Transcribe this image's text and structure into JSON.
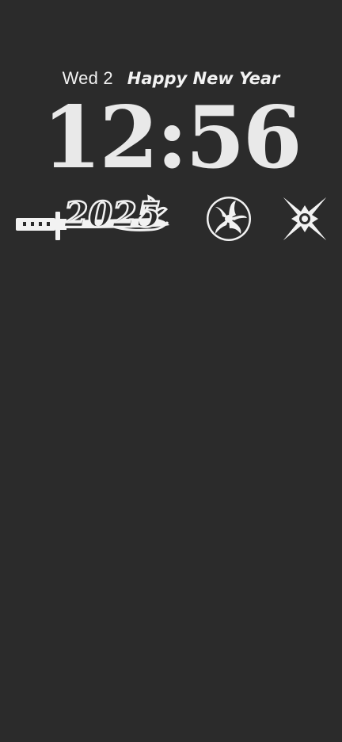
{
  "lockscreen": {
    "date": "Wed 2",
    "greeting": "Happy New Year",
    "time": "12:56"
  },
  "widgets": [
    {
      "icon": "katana-2025-icon",
      "text": "2025"
    },
    {
      "icon": "sharingan-icon"
    },
    {
      "icon": "shuriken-icon"
    }
  ],
  "colors": {
    "background": "#2b2b2b",
    "foreground": "#f2f2f2"
  }
}
